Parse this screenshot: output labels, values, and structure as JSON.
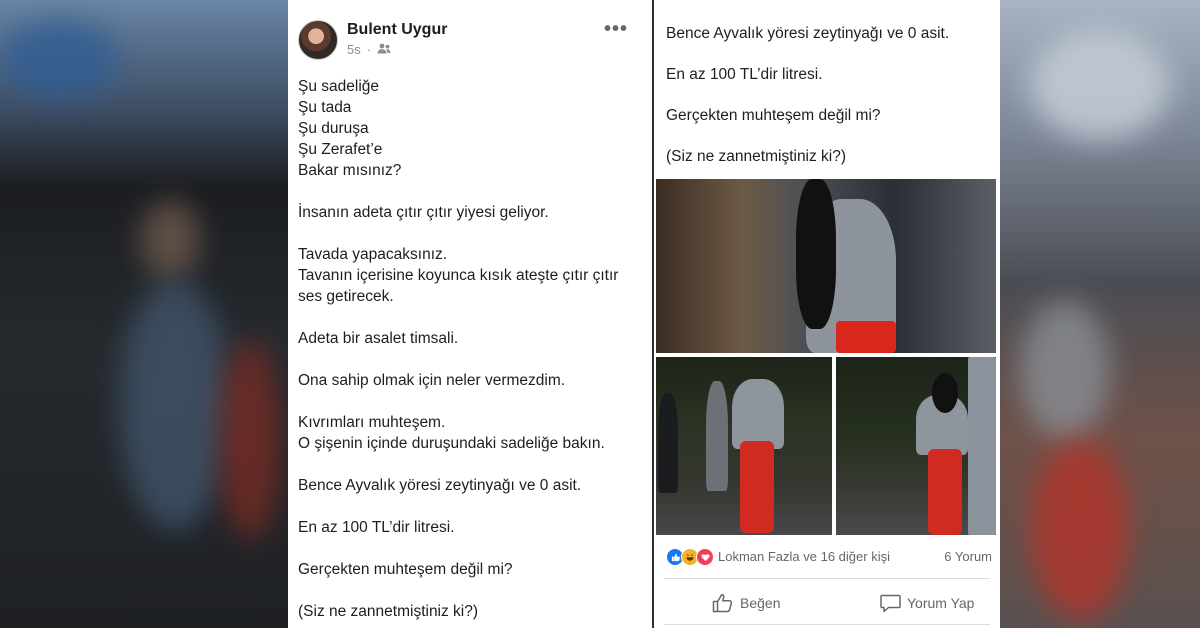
{
  "post": {
    "author": "Bulent Uygur",
    "time": "5s",
    "audience_icon": "friends-icon",
    "more_label": "•••",
    "paragraphs": [
      "Şu sadeliğe\nŞu tada\nŞu duruşa\nŞu Zerafet’e\nBakar mısınız?",
      "İnsanın adeta çıtır çıtır yiyesi geliyor.",
      "Tavada yapacaksınız.\nTavanın içerisine koyunca kısık ateşte çıtır çıtır ses getirecek.",
      "Adeta bir asalet timsali.",
      "Ona sahip olmak için neler vermezdim.",
      "Kıvrımları muhteşem.\nO şişenin içinde duruşundaki sadeliğe bakın.",
      "Bence Ayvalık yöresi zeytinyağı ve 0 asit.",
      "En az 100 TL’dir litresi.",
      "Gerçekten muhteşem değil mi?",
      "(Siz ne zannetmiştiniz ki?)"
    ]
  },
  "right": {
    "paragraphs": [
      "Bence Ayvalık yöresi zeytinyağı ve 0 asit.",
      "En az 100 TL’dir litresi.",
      "Gerçekten muhteşem değil mi?",
      "(Siz ne zannetmiştiniz ki?)"
    ],
    "reactions_label": "Lokman Fazla ve 16 diğer kişi",
    "comments_label": "6 Yorum",
    "like_label": "Beğen",
    "comment_label": "Yorum Yap"
  },
  "colors": {
    "like_blue": "#1877f2",
    "haha_yellow": "#f7b125",
    "love_red": "#f33e58"
  }
}
